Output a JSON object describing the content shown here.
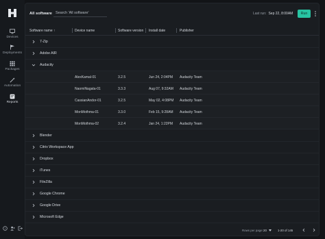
{
  "sidebar": {
    "logo": "H-logo",
    "items": [
      {
        "label": "Devices",
        "icon": "monitor-icon"
      },
      {
        "label": "Deployments",
        "icon": "flag-icon"
      },
      {
        "label": "Packages",
        "icon": "grid-icon"
      },
      {
        "label": "Automation",
        "icon": "wand-icon"
      },
      {
        "label": "Reports",
        "icon": "report-icon"
      }
    ],
    "active": "Reports",
    "footer_icons": [
      "help-icon",
      "user-add-icon",
      "logout-icon"
    ]
  },
  "header": {
    "title": "All software",
    "search_placeholder": "Search 'All software'",
    "last_run_label": "Last run:",
    "last_run_value": "Sep 22, 8:00AM",
    "run_label": "Run"
  },
  "table": {
    "columns": [
      "Software name",
      "Device name",
      "Software version",
      "Install date",
      "Publisher"
    ],
    "sort_indicator": "↑",
    "groups": [
      {
        "name": "7-Zip",
        "expanded": false
      },
      {
        "name": "Adobe AIR",
        "expanded": false
      },
      {
        "name": "Audacity",
        "expanded": true
      },
      {
        "name": "Blender",
        "expanded": false
      },
      {
        "name": "Citrix Workspace App",
        "expanded": false
      },
      {
        "name": "Dropbox",
        "expanded": false
      },
      {
        "name": "iTunes",
        "expanded": false
      },
      {
        "name": "FileZilla",
        "expanded": false
      },
      {
        "name": "Google Chrome",
        "expanded": false
      },
      {
        "name": "Google Drive",
        "expanded": false
      },
      {
        "name": "Microsoft Edge",
        "expanded": false
      }
    ],
    "audacity_rows": [
      {
        "device": "AlexKamal-01",
        "version": "3.2.5",
        "date": "Jun 24, 2:04PM",
        "publisher": "Audacity Team"
      },
      {
        "device": "NaomiNagata-01",
        "version": "3.3.3",
        "date": "Aug 07, 9:32AM",
        "publisher": "Audacity Team"
      },
      {
        "device": "CassianAndor-01",
        "version": "3.2.5",
        "date": "May 02, 4:08PM",
        "publisher": "Audacity Team"
      },
      {
        "device": "MonMothma-01",
        "version": "3.3.0",
        "date": "Feb 15, 9:28AM",
        "publisher": "Audacity Team"
      },
      {
        "device": "MonMothma-02",
        "version": "3.2.4",
        "date": "Jan 24, 1:22PM",
        "publisher": "Audacity Team"
      }
    ]
  },
  "pagination": {
    "rows_per_page_label": "Rows per page:",
    "rows_per_page_value": "20",
    "range": "1-20 of 145"
  },
  "colors": {
    "accent": "#27c4a2",
    "background": "#121417",
    "panel": "#1a1d21"
  }
}
